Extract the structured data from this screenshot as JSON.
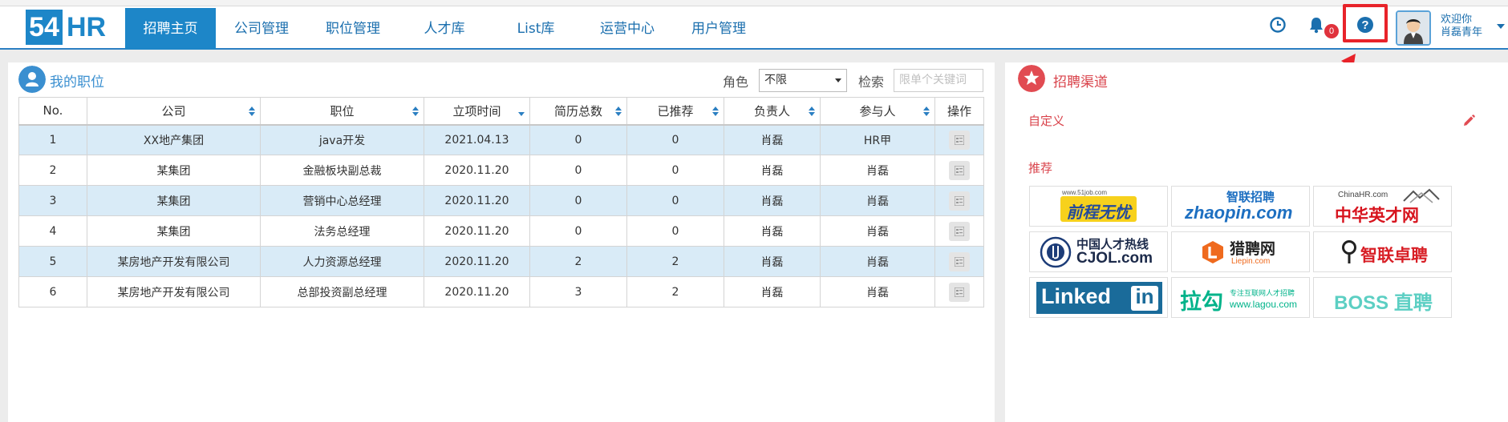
{
  "header": {
    "logo_number": "54",
    "logo_text": "HR",
    "nav": [
      {
        "label": "招聘主页",
        "active": true
      },
      {
        "label": "公司管理",
        "active": false
      },
      {
        "label": "职位管理",
        "active": false
      },
      {
        "label": "人才库",
        "active": false
      },
      {
        "label": "List库",
        "active": false
      },
      {
        "label": "运营中心",
        "active": false
      },
      {
        "label": "用户管理",
        "active": false
      }
    ],
    "notification_count": "0",
    "welcome_line1": "欢迎你",
    "welcome_line2": "肖磊青年",
    "icons": [
      "clock-icon",
      "bell-icon",
      "help-icon",
      "avatar",
      "caret-down-icon"
    ]
  },
  "my_jobs": {
    "title": "我的职位",
    "role_label": "角色",
    "role_value": "不限",
    "search_label": "检索",
    "search_placeholder": "限单个关键词",
    "columns": [
      "No.",
      "公司",
      "职位",
      "立项时间",
      "简历总数",
      "已推荐",
      "负责人",
      "参与人",
      "操作"
    ],
    "rows": [
      {
        "no": "1",
        "company": "XX地产集团",
        "position": "java开发",
        "date": "2021.04.13",
        "resumes": "0",
        "recommended": "0",
        "owner": "肖磊",
        "participant": "HR甲"
      },
      {
        "no": "2",
        "company": "某集团",
        "position": "金融板块副总裁",
        "date": "2020.11.20",
        "resumes": "0",
        "recommended": "0",
        "owner": "肖磊",
        "participant": "肖磊"
      },
      {
        "no": "3",
        "company": "某集团",
        "position": "营销中心总经理",
        "date": "2020.11.20",
        "resumes": "0",
        "recommended": "0",
        "owner": "肖磊",
        "participant": "肖磊"
      },
      {
        "no": "4",
        "company": "某集团",
        "position": "法务总经理",
        "date": "2020.11.20",
        "resumes": "0",
        "recommended": "0",
        "owner": "肖磊",
        "participant": "肖磊"
      },
      {
        "no": "5",
        "company": "某房地产开发有限公司",
        "position": "人力资源总经理",
        "date": "2020.11.20",
        "resumes": "2",
        "recommended": "2",
        "owner": "肖磊",
        "participant": "肖磊"
      },
      {
        "no": "6",
        "company": "某房地产开发有限公司",
        "position": "总部投资副总经理",
        "date": "2020.11.20",
        "resumes": "3",
        "recommended": "2",
        "owner": "肖磊",
        "participant": "肖磊"
      }
    ]
  },
  "channels": {
    "title": "招聘渠道",
    "custom_label": "自定义",
    "recommended_label": "推荐",
    "logos": [
      {
        "name": "51job",
        "caption": "前程无忧",
        "sub": "www.51job.com"
      },
      {
        "name": "zhaopin",
        "caption": "zhaopin.com",
        "sub": "智联招聘"
      },
      {
        "name": "chinahr",
        "caption": "中华英才网",
        "sub": "ChinaHR.com"
      },
      {
        "name": "cjol",
        "caption": "CJOL.com",
        "sub": "中国人才热线"
      },
      {
        "name": "liepin",
        "caption": "猎聘网",
        "sub": "Liepin.com"
      },
      {
        "name": "zhilian-zhuopin",
        "caption": "智联卓聘",
        "sub": ""
      },
      {
        "name": "linkedin",
        "caption": "Linked",
        "sub": "in"
      },
      {
        "name": "lagou",
        "caption": "拉勾",
        "sub": "www.lagou.com",
        "tagline": "专注互联网人才招聘"
      },
      {
        "name": "boss",
        "caption": "BOSS 直聘",
        "sub": ""
      }
    ]
  },
  "colors": {
    "brand": "#1d86c8",
    "nav_text": "#1b6fae",
    "accent_red": "#e8232a",
    "row_stripe": "#d9ebf7",
    "channel_red": "#d9434b"
  }
}
